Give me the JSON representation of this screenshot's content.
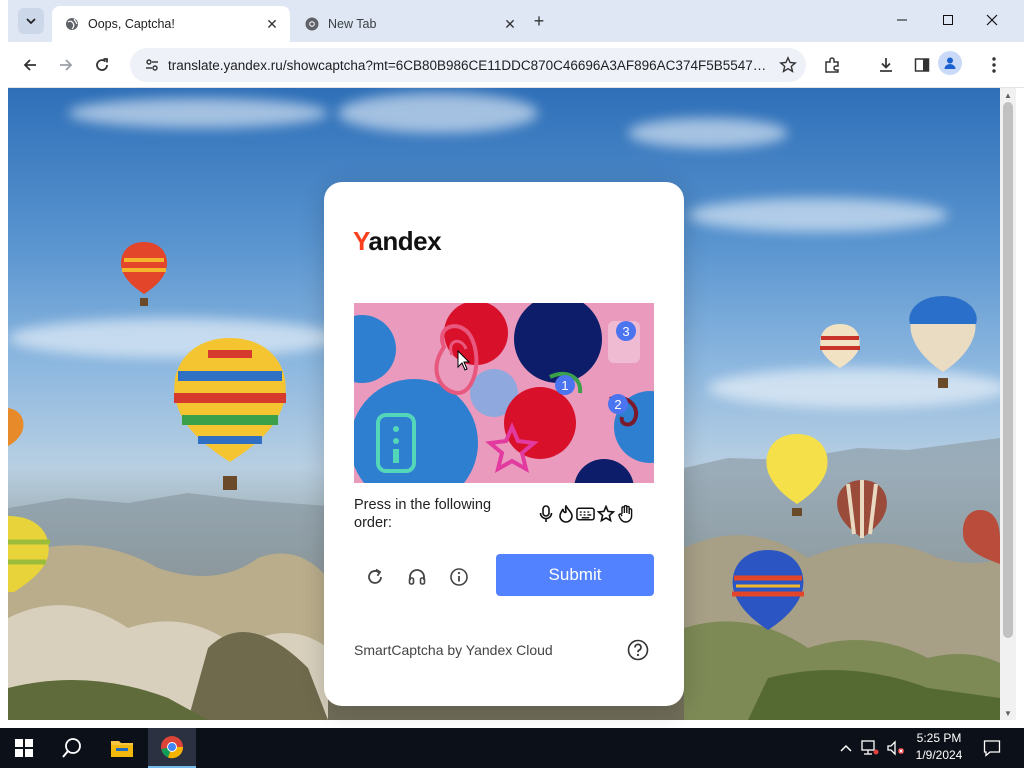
{
  "browser": {
    "tabs": [
      {
        "title": "Oops, Captcha!",
        "favicon": "globe-icon",
        "active": true
      },
      {
        "title": "New Tab",
        "favicon": "chrome-icon",
        "active": false
      }
    ],
    "address_bar": {
      "url": "translate.yandex.ru/showcaptcha?mt=6CB80B986CE11DDC870C46696A3AF896AC374F5B5547E..."
    },
    "toolbar_icons": [
      "back-icon",
      "forward-icon",
      "reload-icon",
      "site-info-icon",
      "bookmark-star-icon",
      "extensions-icon",
      "download-icon",
      "side-panel-icon",
      "profile-icon",
      "menu-icon"
    ]
  },
  "captcha": {
    "logo_first": "Y",
    "logo_rest": "andex",
    "instruction": "Press in the following order:",
    "order_icons": [
      "microphone-icon",
      "fire-icon",
      "keyboard-icon",
      "star-icon",
      "hand-icon"
    ],
    "markers": [
      "1",
      "2",
      "3"
    ],
    "submit_label": "Submit",
    "footer": "SmartCaptcha by Yandex Cloud",
    "colors": {
      "accent": "#5282ff",
      "logo_accent": "#fc3f1d",
      "marker": "#4b74f0"
    }
  },
  "taskbar": {
    "time": "5:25 PM",
    "date": "1/9/2024",
    "apps": [
      "start-icon",
      "search-icon",
      "file-explorer-icon",
      "chrome-icon"
    ]
  }
}
